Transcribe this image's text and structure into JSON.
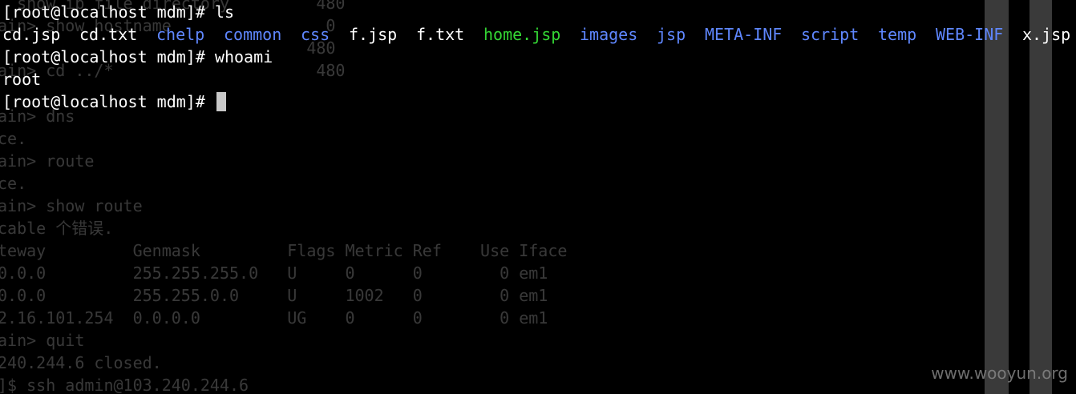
{
  "terminal": {
    "background": "#000000",
    "lines": {
      "line1": "[root@localhost mdm]# ls",
      "line3": "[root@localhost mdm]# whoami",
      "line4": "root",
      "line5": "[root@localhost mdm]# "
    },
    "ls_output": [
      {
        "name": "cd.jsp",
        "type": "file"
      },
      {
        "name": "cd.txt",
        "type": "file"
      },
      {
        "name": "chelp",
        "type": "dir"
      },
      {
        "name": "common",
        "type": "dir"
      },
      {
        "name": "css",
        "type": "dir"
      },
      {
        "name": "f.jsp",
        "type": "file"
      },
      {
        "name": "f.txt",
        "type": "file"
      },
      {
        "name": "home.jsp",
        "type": "exe"
      },
      {
        "name": "images",
        "type": "dir"
      },
      {
        "name": "jsp",
        "type": "dir"
      },
      {
        "name": "META-INF",
        "type": "dir"
      },
      {
        "name": "script",
        "type": "dir"
      },
      {
        "name": "temp",
        "type": "dir"
      },
      {
        "name": "WEB-INF",
        "type": "dir"
      },
      {
        "name": "x.jsp",
        "type": "file"
      }
    ],
    "colors": {
      "dir": "#5f87ff",
      "exe": "#34d634",
      "file": "#ffffff"
    }
  },
  "ghost": {
    "g0": "  show ip file directory         480",
    "g1": "ain> show hostname                0",
    "g2": "                                480",
    "g3": "ain> cd ../*                     480",
    "g5": "ain> dns",
    "g6": "ce.",
    "g7": "ain> route",
    "g8": "ce.",
    "g9": "ain> show route",
    "g10": "cable 个错误.",
    "g11": "teway         Genmask         Flags Metric Ref    Use Iface",
    "g12": "0.0.0         255.255.255.0   U     0      0        0 em1",
    "g13": "0.0.0         255.255.0.0     U     1002   0        0 em1",
    "g14": "2.16.101.254  0.0.0.0         UG    0      0        0 em1",
    "g15": "ain> quit",
    "g16": "240.244.6 closed.",
    "g17": "]$ ssh admin@103.240.244.6"
  },
  "watermark": "www.wooyun.org"
}
